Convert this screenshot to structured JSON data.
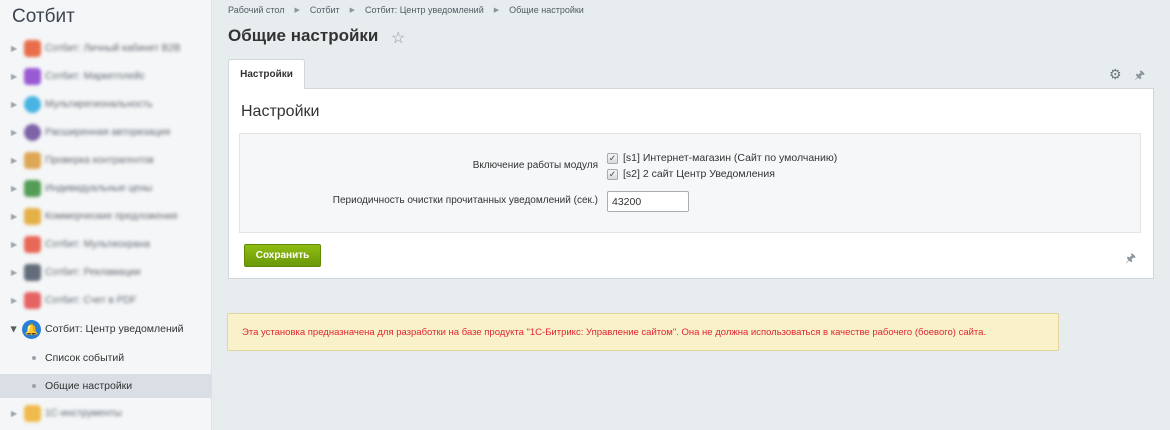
{
  "sidebar": {
    "title": "Сотбит",
    "items": [
      {
        "label": "Сотбит: Личный кабинет B2B",
        "icon": "b2b-icon",
        "color": "#e8562b"
      },
      {
        "label": "Сотбит: Маркетплейс",
        "icon": "marketplace-icon",
        "color": "#8a3fd0"
      },
      {
        "label": "Мультирегиональность",
        "icon": "map-pin-icon",
        "color": "#2aa9de"
      },
      {
        "label": "Расширенная авторизация",
        "icon": "auth-icon",
        "color": "#6a4a9a"
      },
      {
        "label": "Проверка контрагентов",
        "icon": "check-contractors-icon",
        "color": "#d99a3a"
      },
      {
        "label": "Индивидуальные цены",
        "icon": "prices-icon",
        "color": "#3a8d3a"
      },
      {
        "label": "Коммерческие предложения",
        "icon": "offers-icon",
        "color": "#e2a62b"
      },
      {
        "label": "Сотбит: Мультиохрана",
        "icon": "security-icon",
        "color": "#e6503c"
      },
      {
        "label": "Сотбит: Рекламации",
        "icon": "claims-icon",
        "color": "#4a5566"
      },
      {
        "label": "Сотбит: Счет в PDF",
        "icon": "pdf-icon",
        "color": "#e34a4a"
      },
      {
        "label": "Сотбит: Центр уведомлений",
        "icon": "bell-icon",
        "color": "#2a7fd4"
      },
      {
        "label": "1С-инструменты",
        "icon": "tools-icon",
        "color": "#f0b030"
      }
    ],
    "sub_items": [
      {
        "label": "Список событий"
      },
      {
        "label": "Общие настройки"
      }
    ]
  },
  "breadcrumb": [
    "Рабочий стол",
    "Сотбит",
    "Сотбит: Центр уведомлений",
    "Общие настройки"
  ],
  "page_title": "Общие настройки",
  "tabs": [
    {
      "label": "Настройки"
    }
  ],
  "panel": {
    "title": "Настройки",
    "module_label": "Включение работы модуля",
    "sites": [
      {
        "label": "[s1] Интернет-магазин (Сайт по умолчанию)",
        "checked": true
      },
      {
        "label": "[s2] 2 сайт Центр Уведомления",
        "checked": true
      }
    ],
    "cleanup_label": "Периодичность очистки прочитанных уведомлений (сек.)",
    "cleanup_value": "43200",
    "save_label": "Сохранить"
  },
  "warning": "Эта установка предназначена для разработки на базе продукта \"1С-Битрикс: Управление сайтом\". Она не должна использоваться в качестве рабочего (боевого) сайта.",
  "colors": {
    "save_button": "#7aa80c",
    "warning_text": "#e0262f",
    "warning_bg": "#f8f1c9"
  }
}
